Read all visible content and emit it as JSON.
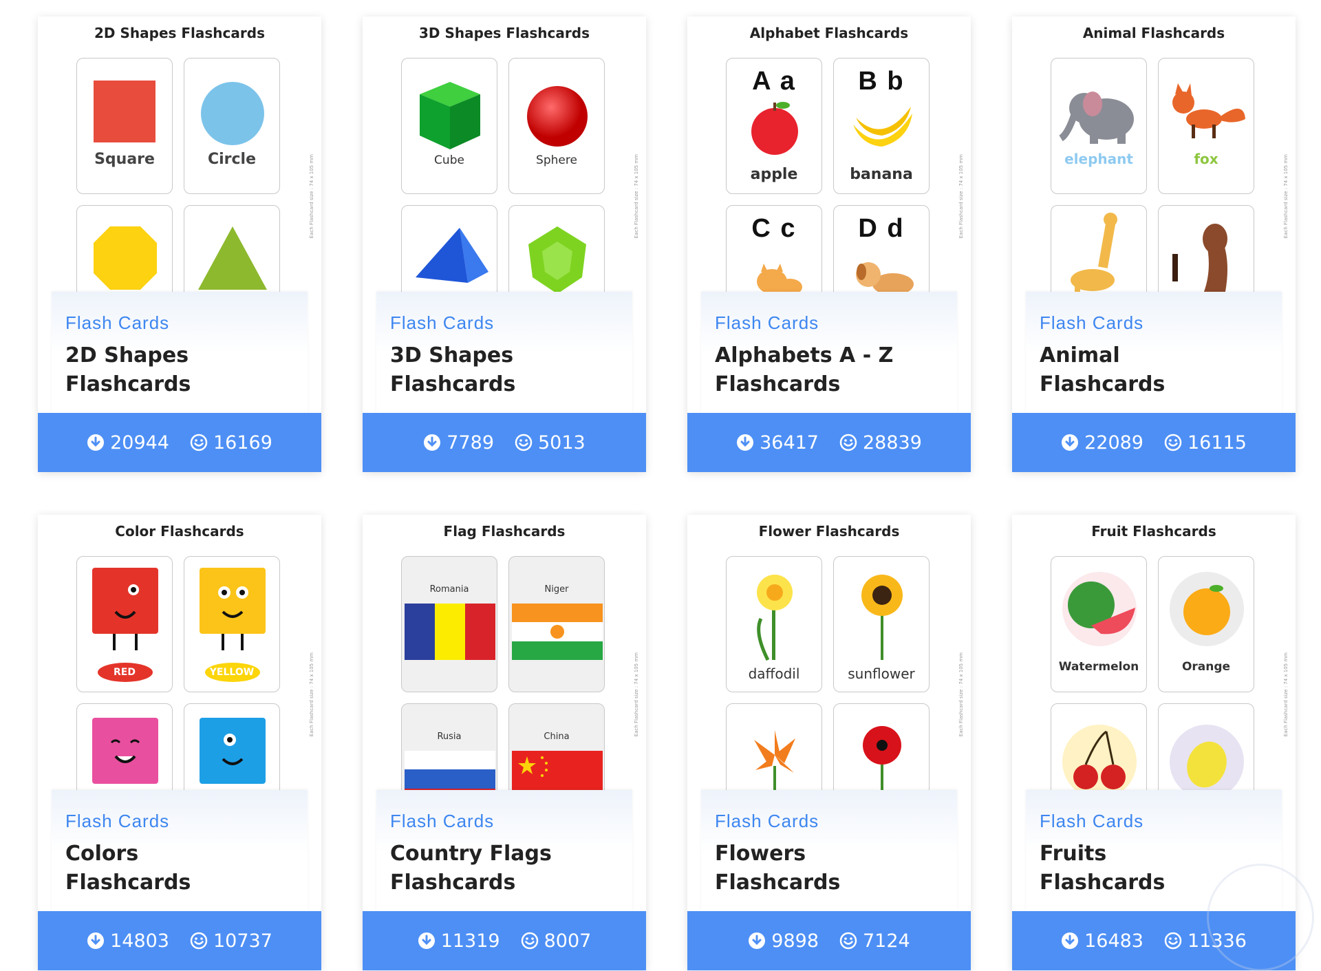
{
  "colors": {
    "accent": "#4d8ff5",
    "subtitle": "#3d86f0"
  },
  "cards": [
    {
      "preview_title": "2D Shapes Flashcards",
      "mini": [
        "Square",
        "Circle",
        "",
        ""
      ],
      "subtitle": "Flash Cards",
      "title_line1": "2D Shapes",
      "title_line2": "Flashcards",
      "downloads": "20944",
      "likes": "16169"
    },
    {
      "preview_title": "3D Shapes Flashcards",
      "mini": [
        "Cube",
        "Sphere",
        "",
        ""
      ],
      "subtitle": "Flash Cards",
      "title_line1": "3D Shapes",
      "title_line2": "Flashcards",
      "downloads": "7789",
      "likes": "5013"
    },
    {
      "preview_title": "Alphabet Flashcards",
      "mini": [
        "apple",
        "banana",
        "",
        ""
      ],
      "letters": [
        "A a",
        "B b",
        "C c",
        "D d"
      ],
      "subtitle": "Flash Cards",
      "title_line1": "Alphabets A - Z",
      "title_line2": "Flashcards",
      "downloads": "36417",
      "likes": "28839"
    },
    {
      "preview_title": "Animal Flashcards",
      "mini": [
        "elephant",
        "fox",
        "",
        ""
      ],
      "subtitle": "Flash Cards",
      "title_line1": "Animal",
      "title_line2": "Flashcards",
      "downloads": "22089",
      "likes": "16115"
    },
    {
      "preview_title": "Color Flashcards",
      "mini": [
        "RED",
        "YELLOW",
        "",
        ""
      ],
      "subtitle": "Flash Cards",
      "title_line1": "Colors",
      "title_line2": "Flashcards",
      "downloads": "14803",
      "likes": "10737"
    },
    {
      "preview_title": "Flag Flashcards",
      "mini": [
        "Romania",
        "Niger",
        "Rusia",
        "China"
      ],
      "subtitle": "Flash Cards",
      "title_line1": "Country Flags",
      "title_line2": "Flashcards",
      "downloads": "11319",
      "likes": "8007"
    },
    {
      "preview_title": "Flower Flashcards",
      "mini": [
        "daffodil",
        "sunflower",
        "",
        ""
      ],
      "subtitle": "Flash Cards",
      "title_line1": "Flowers",
      "title_line2": "Flashcards",
      "downloads": "9898",
      "likes": "7124"
    },
    {
      "preview_title": "Fruit Flashcards",
      "mini": [
        "Watermelon",
        "Orange",
        "",
        ""
      ],
      "subtitle": "Flash Cards",
      "title_line1": "Fruits",
      "title_line2": "Flashcards",
      "downloads": "16483",
      "likes": "11336"
    }
  ],
  "side_note": "Each Flashcard size : 74 x 105 mm",
  "icons": {
    "download": "download-circle-icon",
    "like": "smiley-icon"
  }
}
